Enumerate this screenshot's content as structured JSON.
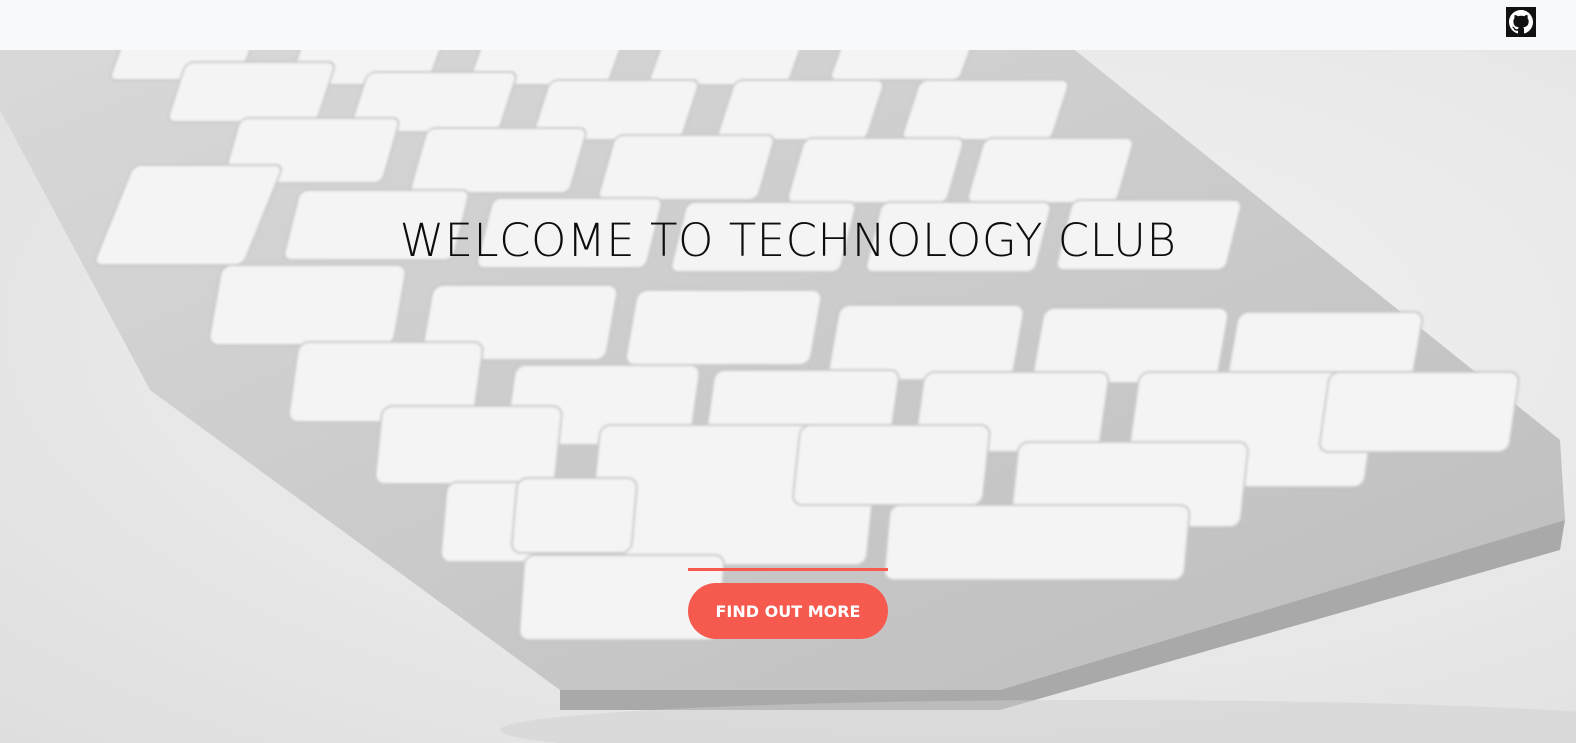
{
  "navbar": {
    "github_icon": "github-icon"
  },
  "hero": {
    "title": "WELCOME TO TECHNOLOGY CLUB",
    "cta_label": "FIND OUT MORE",
    "background_subject": "keyboard-photo"
  },
  "colors": {
    "accent": "#f65a4f",
    "navbar_bg": "#f8f9fb",
    "title_text": "#0d0d0d",
    "button_text": "#ffffff"
  }
}
